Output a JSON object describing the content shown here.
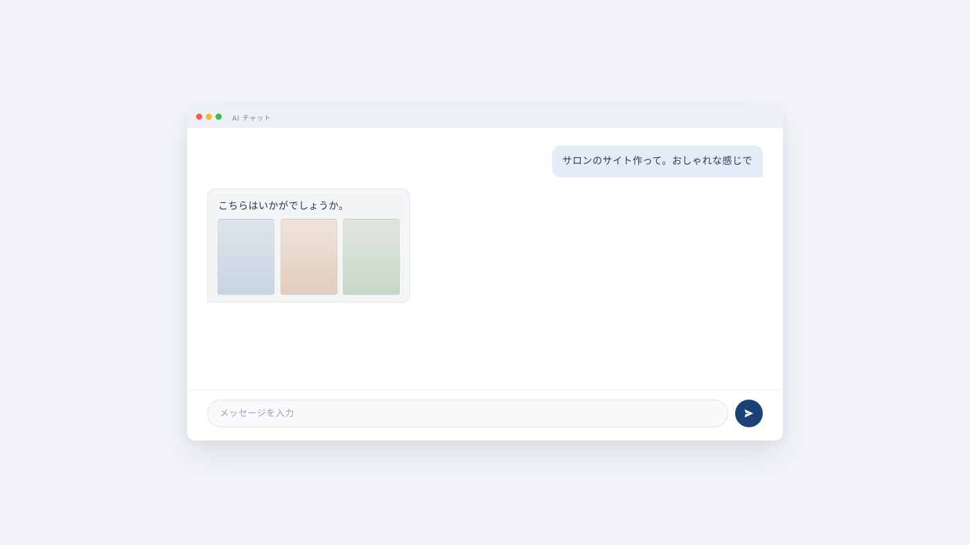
{
  "window": {
    "title": "AI チャット"
  },
  "messages": {
    "user": "サロンのサイト作って。おしゃれな感じで",
    "assistant": "こちらはいかがでしょうか。"
  },
  "input": {
    "placeholder": "メッセージを入力",
    "value": ""
  },
  "icons": {
    "send": "send-icon"
  },
  "colors": {
    "accent": "#1b4277",
    "user_bubble": "#e4ecf7",
    "assistant_bubble": "#f4f5f7",
    "thumbnail_1": "#c9d5e0",
    "thumbnail_2": "#e1cdbd",
    "thumbnail_3": "#c8d7c9"
  }
}
